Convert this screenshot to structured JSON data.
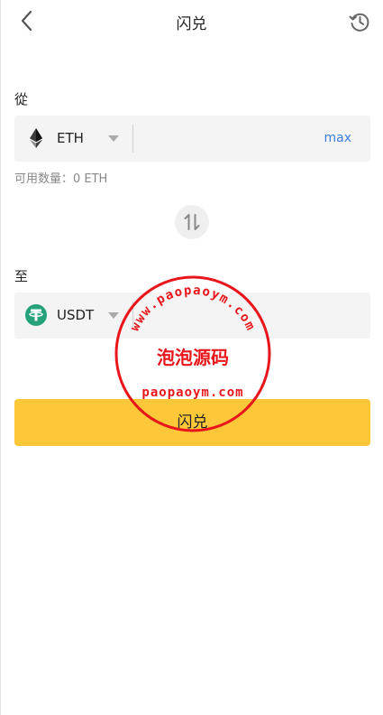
{
  "header": {
    "title": "闪兑",
    "back_icon": "chevron-left-icon",
    "history_icon": "history-icon"
  },
  "from": {
    "label": "從",
    "token": {
      "symbol": "ETH",
      "icon": "ethereum-icon"
    },
    "amount_value": "",
    "max_label": "max",
    "available_text": "可用数量：0 ETH"
  },
  "switch_icon": "swap-arrows-icon",
  "to": {
    "label": "至",
    "token": {
      "symbol": "USDT",
      "icon": "tether-icon"
    },
    "amount_value": ""
  },
  "swap_button": {
    "label": "闪兑"
  },
  "watermark": {
    "top_text": "www.paopaoym.com",
    "middle_text": "泡泡源码",
    "bottom_text": "paopaoym.com",
    "color": "#e8161b"
  },
  "colors": {
    "accent_button": "#fcc83a",
    "link": "#3a7ee0",
    "tether": "#26a17b"
  }
}
